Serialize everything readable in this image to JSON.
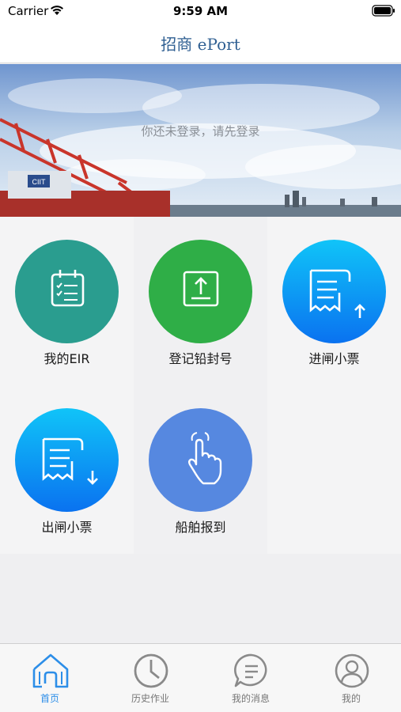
{
  "status_bar": {
    "carrier": "Carrier",
    "time": "9:59 AM"
  },
  "nav": {
    "title": "招商 ePort"
  },
  "banner": {
    "login_hint": "你还未登录，请先登录"
  },
  "grid": {
    "items": [
      {
        "label": "我的EIR",
        "icon": "calendar-checklist-icon",
        "color": "#2a9d8f"
      },
      {
        "label": "登记铅封号",
        "icon": "upload-tray-icon",
        "color": "#2fae47"
      },
      {
        "label": "进闸小票",
        "icon": "receipt-up-icon",
        "color": "#1aa4f5"
      },
      {
        "label": "出闸小票",
        "icon": "receipt-down-icon",
        "color": "#1aa4f5"
      },
      {
        "label": "船舶报到",
        "icon": "tap-hand-icon",
        "color": "#5688e0"
      }
    ]
  },
  "tabbar": {
    "tabs": [
      {
        "label": "首页",
        "icon": "home-icon",
        "active": true
      },
      {
        "label": "历史作业",
        "icon": "clock-icon",
        "active": false
      },
      {
        "label": "我的消息",
        "icon": "message-icon",
        "active": false
      },
      {
        "label": "我的",
        "icon": "user-icon",
        "active": false
      }
    ]
  },
  "colors": {
    "accent": "#2c8ee8",
    "title": "#2f5f92"
  }
}
